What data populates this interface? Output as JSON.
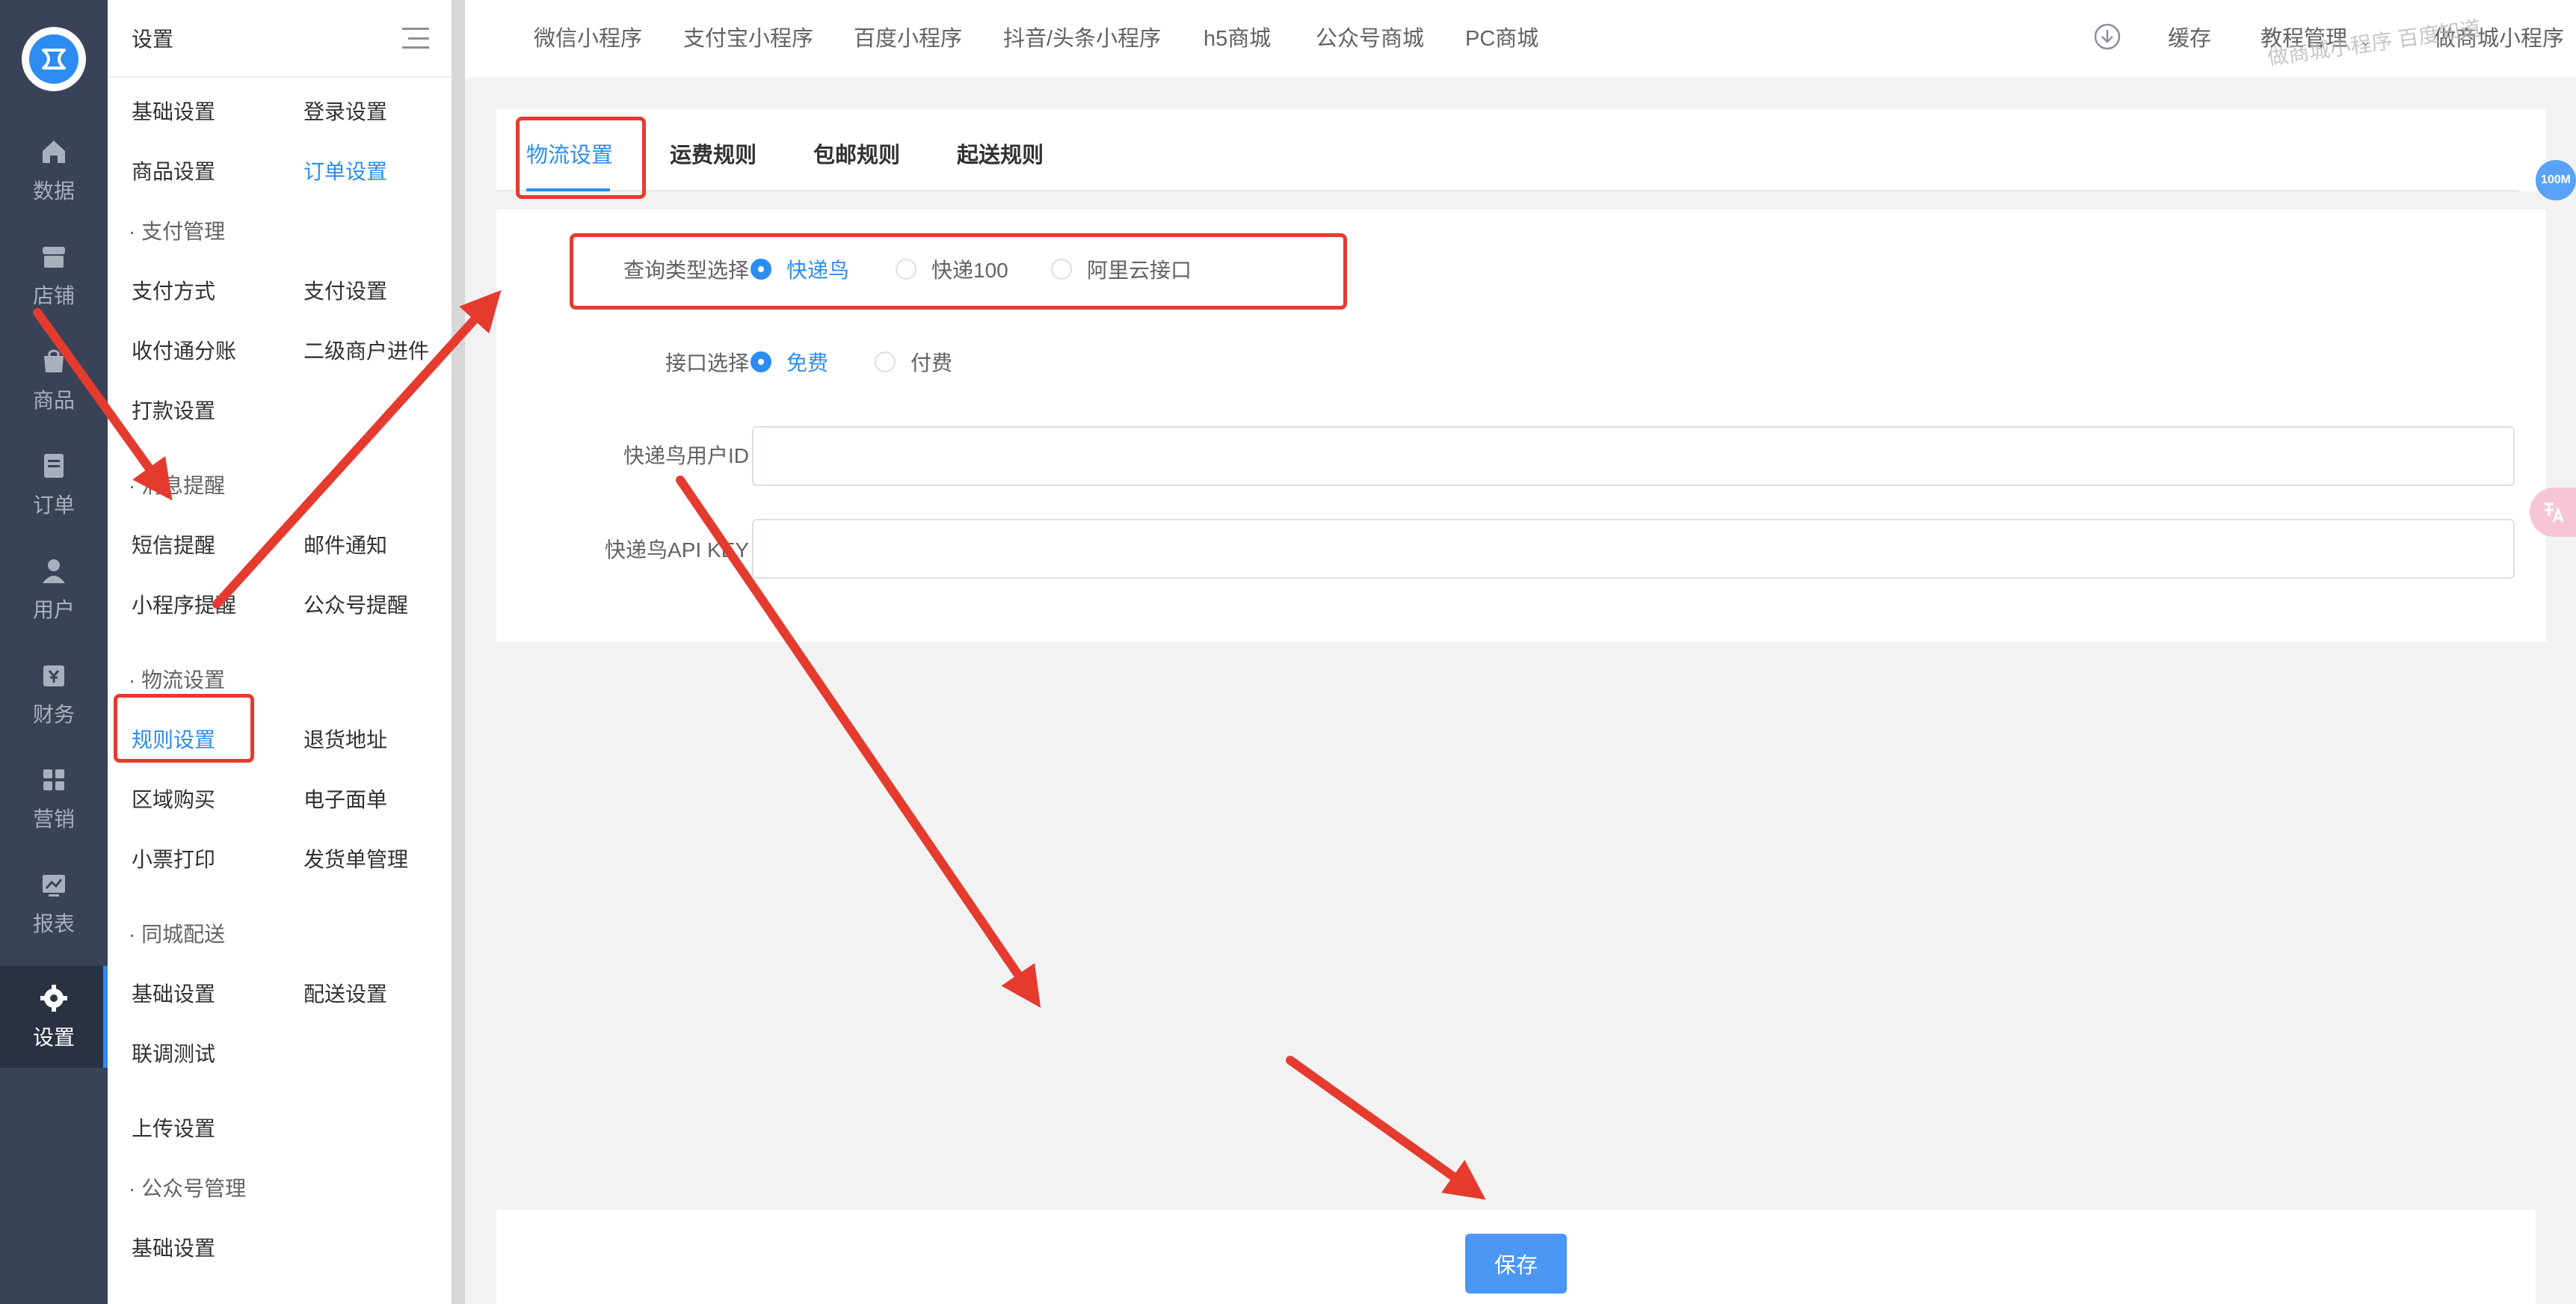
{
  "rail": {
    "items": [
      {
        "label": "数据",
        "icon": "home-icon"
      },
      {
        "label": "店铺",
        "icon": "store-icon"
      },
      {
        "label": "商品",
        "icon": "bag-icon"
      },
      {
        "label": "订单",
        "icon": "document-icon"
      },
      {
        "label": "用户",
        "icon": "user-icon"
      },
      {
        "label": "财务",
        "icon": "finance-icon"
      },
      {
        "label": "营销",
        "icon": "grid-icon"
      },
      {
        "label": "报表",
        "icon": "chart-icon"
      },
      {
        "label": "设置",
        "icon": "gear-icon"
      }
    ],
    "active": "设置"
  },
  "submenu": {
    "title": "设置",
    "basic_settings": "基础设置",
    "login_settings": "登录设置",
    "goods_settings": "商品设置",
    "order_settings": "订单设置",
    "group_payment": "· 支付管理",
    "payment_method": "支付方式",
    "payment_settings": "支付设置",
    "split_account": "收付通分账",
    "sub_merchant": "二级商户进件",
    "transfer_settings": "打款设置",
    "group_message": "· 消息提醒",
    "sms_reminder": "短信提醒",
    "email_notice": "邮件通知",
    "mini_reminder": "小程序提醒",
    "official_reminder": "公众号提醒",
    "group_logistics": "· 物流设置",
    "rule_settings": "规则设置",
    "return_address": "退货地址",
    "region_purchase": "区域购买",
    "e_waybill": "电子面单",
    "receipt_print": "小票打印",
    "shipment_manage": "发货单管理",
    "group_city": "· 同城配送",
    "city_basic": "基础设置",
    "delivery_settings": "配送设置",
    "joint_test": "联调测试",
    "upload_settings": "上传设置",
    "group_official": "· 公众号管理",
    "official_basic": "基础设置"
  },
  "topbar": {
    "nav": [
      "微信小程序",
      "支付宝小程序",
      "百度小程序",
      "抖音/头条小程序",
      "h5商城",
      "公众号商城",
      "PC商城"
    ],
    "cache": "缓存",
    "tutorial": "教程管理",
    "user": "做商城小程序",
    "watermark": "做商城小程序 百度知道"
  },
  "tabs": {
    "items": [
      "物流设置",
      "运费规则",
      "包邮规则",
      "起送规则"
    ],
    "active": "物流设置"
  },
  "form": {
    "query_type_label": "查询类型选择",
    "query_options": [
      "快递鸟",
      "快递100",
      "阿里云接口"
    ],
    "query_selected": "快递鸟",
    "api_label": "接口选择",
    "api_options": [
      "免费",
      "付费"
    ],
    "api_selected": "免费",
    "user_id_label": "快递鸟用户ID",
    "user_id_value": "",
    "api_key_label": "快递鸟API KEY",
    "api_key_value": ""
  },
  "footer": {
    "save_label": "保存"
  },
  "badges": {
    "speed": "100M"
  },
  "colors": {
    "accent": "#2d8cf0",
    "rail_bg": "#3a4257",
    "annotation": "#e53b2f"
  }
}
